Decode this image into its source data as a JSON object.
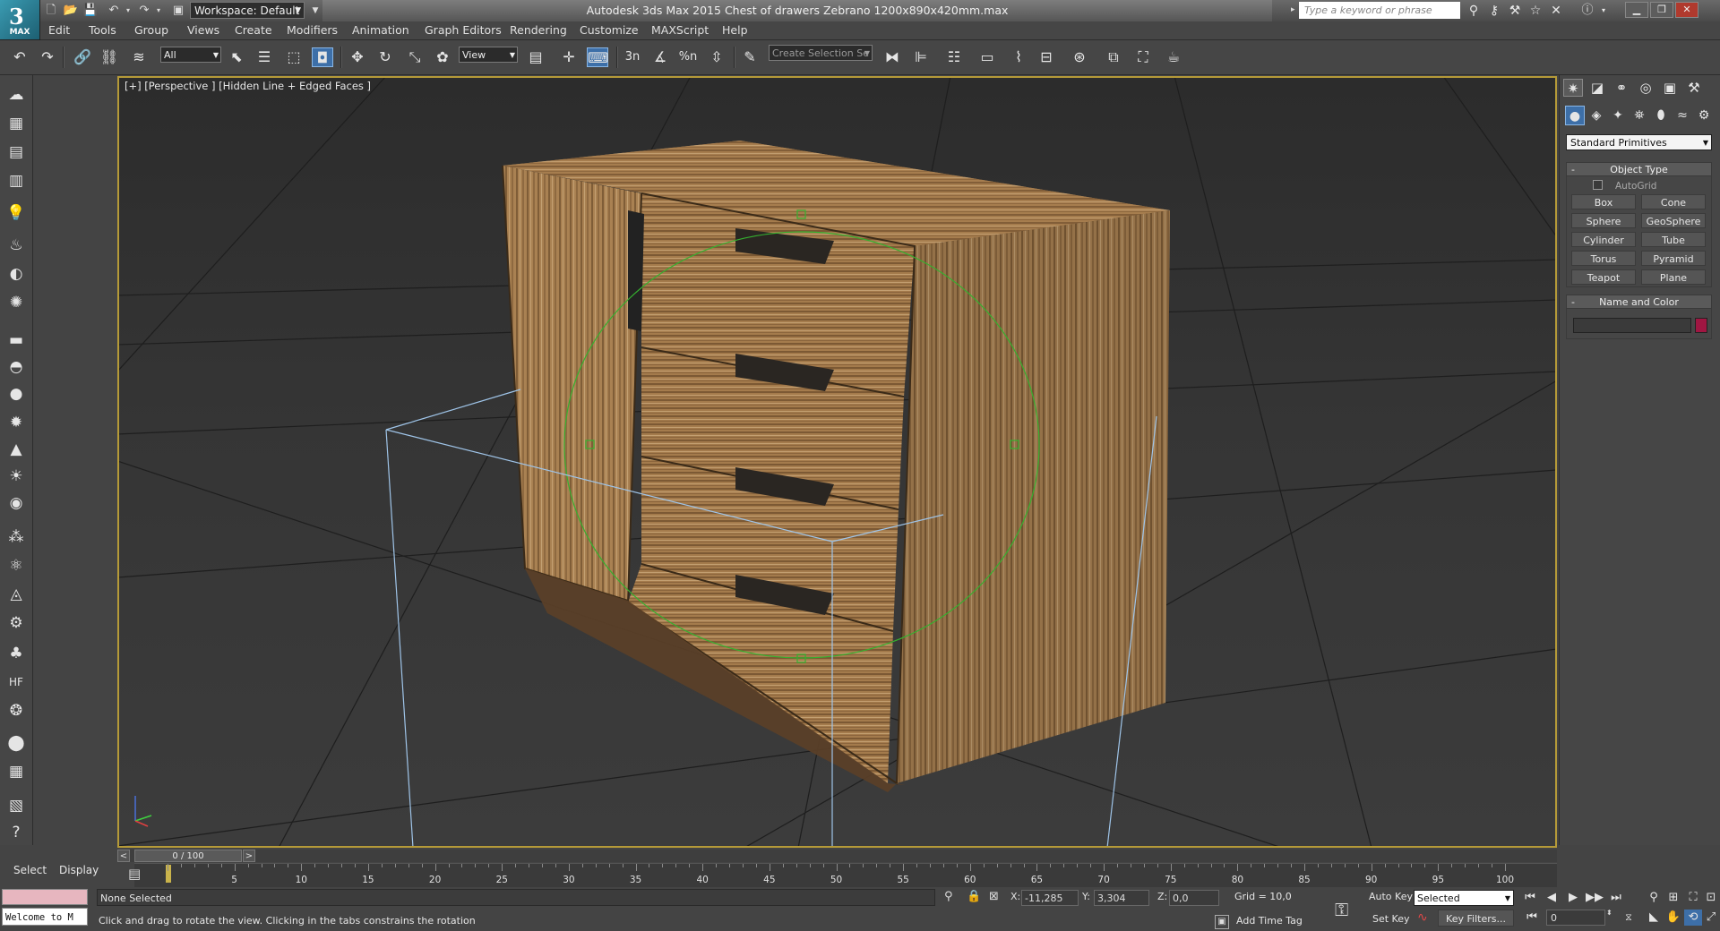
{
  "app": {
    "logo_text": "MAX",
    "workspace_label": "Workspace: Default",
    "window_title": "Autodesk 3ds Max  2015      Chest of drawers Zebrano 1200x890x420mm.max",
    "search_placeholder": "Type a keyword or phrase"
  },
  "menu": [
    "Edit",
    "Tools",
    "Group",
    "Views",
    "Create",
    "Modifiers",
    "Animation",
    "Graph Editors",
    "Rendering",
    "Customize",
    "MAXScript",
    "Help"
  ],
  "toolbar": {
    "filter_select": "All",
    "coord_select": "View",
    "selection_set_placeholder": "Create Selection Se",
    "snap_labels": [
      "3",
      "n",
      "%",
      "n"
    ]
  },
  "viewport": {
    "label": "[+] [Perspective ] [Hidden Line + Edged Faces ]"
  },
  "command_panel": {
    "category_select": "Standard Primitives",
    "object_type_title": "Object Type",
    "autogrid_label": "AutoGrid",
    "object_buttons": [
      "Box",
      "Cone",
      "Sphere",
      "GeoSphere",
      "Cylinder",
      "Tube",
      "Torus",
      "Pyramid",
      "Teapot",
      "Plane"
    ],
    "name_color_title": "Name and Color",
    "object_color": "#a01642"
  },
  "timeline": {
    "slider_label": "0 / 100",
    "ticks": [
      0,
      5,
      10,
      15,
      20,
      25,
      30,
      35,
      40,
      45,
      50,
      55,
      60,
      65,
      70,
      75,
      80,
      85,
      90,
      95,
      100
    ]
  },
  "status": {
    "select_btn": "Select",
    "display_btn": "Display",
    "welcome_text": "Welcome to M",
    "selection_info": "None Selected",
    "prompt": "Click and drag to rotate the view.  Clicking in the tabs constrains the rotation",
    "x_label": "X:",
    "x_value": "-11,285",
    "y_label": "Y:",
    "y_value": "3,304",
    "z_label": "Z:",
    "z_value": "0,0",
    "grid": "Grid = 10,0",
    "add_time_tag": "Add Time Tag",
    "auto_key": "Auto Key",
    "set_key": "Set Key",
    "key_mode": "Selected",
    "key_filters": "Key Filters...",
    "current_frame": "0"
  }
}
